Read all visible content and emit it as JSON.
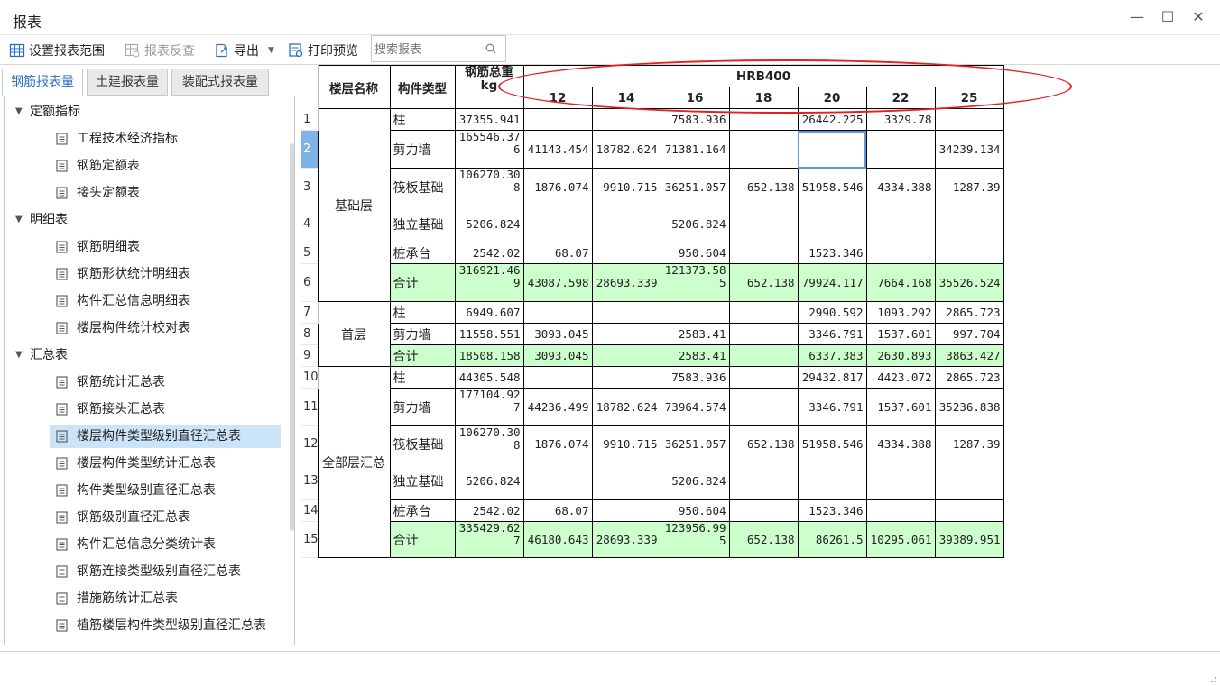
{
  "window": {
    "title": "报表",
    "minimize": "—",
    "maximize": "☐",
    "close": "✕"
  },
  "toolbar": {
    "set_range": "设置报表范围",
    "reverse_check": "报表反查",
    "export": "导出",
    "print_preview": "打印预览",
    "search_placeholder": "搜索报表"
  },
  "tabs": [
    "钢筋报表量",
    "土建报表量",
    "装配式报表量"
  ],
  "tree": {
    "groups": [
      {
        "label": "定额指标",
        "items": [
          "工程技术经济指标",
          "钢筋定额表",
          "接头定额表"
        ]
      },
      {
        "label": "明细表",
        "items": [
          "钢筋明细表",
          "钢筋形状统计明细表",
          "构件汇总信息明细表",
          "楼层构件统计校对表"
        ]
      },
      {
        "label": "汇总表",
        "items": [
          "钢筋统计汇总表",
          "钢筋接头汇总表",
          "楼层构件类型级别直径汇总表",
          "楼层构件类型统计汇总表",
          "构件类型级别直径汇总表",
          "钢筋级别直径汇总表",
          "构件汇总信息分类统计表",
          "钢筋连接类型级别直径汇总表",
          "措施筋统计汇总表",
          "植筋楼层构件类型级别直径汇总表"
        ]
      }
    ],
    "selected": "楼层构件类型级别直径汇总表"
  },
  "report": {
    "headers": {
      "floor": "楼层名称",
      "type": "构件类型",
      "total": "钢筋总重kg",
      "grade": "HRB400",
      "diameters": [
        "12",
        "14",
        "16",
        "18",
        "20",
        "22",
        "25"
      ]
    },
    "groups": [
      {
        "floor": "基础层",
        "rows": [
          {
            "no": "1",
            "type": "柱",
            "total": "37355.941",
            "vals": [
              "",
              "",
              "7583.936",
              "",
              "26442.225",
              "3329.78",
              ""
            ]
          },
          {
            "no": "2",
            "type": "剪力墙",
            "total": "165546.376",
            "vals": [
              "41143.454",
              "18782.624",
              "71381.164",
              "",
              "",
              "",
              "34239.134"
            ]
          },
          {
            "no": "3",
            "type": "筏板基础",
            "total": "106270.308",
            "vals": [
              "1876.074",
              "9910.715",
              "36251.057",
              "652.138",
              "51958.546",
              "4334.388",
              "1287.39"
            ]
          },
          {
            "no": "4",
            "type": "独立基础",
            "total": "5206.824",
            "vals": [
              "",
              "",
              "5206.824",
              "",
              "",
              "",
              ""
            ]
          },
          {
            "no": "5",
            "type": "桩承台",
            "total": "2542.02",
            "vals": [
              "68.07",
              "",
              "950.604",
              "",
              "1523.346",
              "",
              ""
            ]
          },
          {
            "no": "6",
            "type": "合计",
            "total": "316921.469",
            "vals": [
              "43087.598",
              "28693.339",
              "121373.585",
              "652.138",
              "79924.117",
              "7664.168",
              "35526.524"
            ],
            "sum": true
          }
        ]
      },
      {
        "floor": "首层",
        "rows": [
          {
            "no": "7",
            "type": "柱",
            "total": "6949.607",
            "vals": [
              "",
              "",
              "",
              "",
              "2990.592",
              "1093.292",
              "2865.723"
            ]
          },
          {
            "no": "8",
            "type": "剪力墙",
            "total": "11558.551",
            "vals": [
              "3093.045",
              "",
              "2583.41",
              "",
              "3346.791",
              "1537.601",
              "997.704"
            ]
          },
          {
            "no": "9",
            "type": "合计",
            "total": "18508.158",
            "vals": [
              "3093.045",
              "",
              "2583.41",
              "",
              "6337.383",
              "2630.893",
              "3863.427"
            ],
            "sum": true
          }
        ]
      },
      {
        "floor": "全部层汇总",
        "rows": [
          {
            "no": "10",
            "type": "柱",
            "total": "44305.548",
            "vals": [
              "",
              "",
              "7583.936",
              "",
              "29432.817",
              "4423.072",
              "2865.723"
            ]
          },
          {
            "no": "11",
            "type": "剪力墙",
            "total": "177104.927",
            "vals": [
              "44236.499",
              "18782.624",
              "73964.574",
              "",
              "3346.791",
              "1537.601",
              "35236.838"
            ]
          },
          {
            "no": "12",
            "type": "筏板基础",
            "total": "106270.308",
            "vals": [
              "1876.074",
              "9910.715",
              "36251.057",
              "652.138",
              "51958.546",
              "4334.388",
              "1287.39"
            ]
          },
          {
            "no": "13",
            "type": "独立基础",
            "total": "5206.824",
            "vals": [
              "",
              "",
              "5206.824",
              "",
              "",
              "",
              ""
            ]
          },
          {
            "no": "14",
            "type": "桩承台",
            "total": "2542.02",
            "vals": [
              "68.07",
              "",
              "950.604",
              "",
              "1523.346",
              "",
              ""
            ]
          },
          {
            "no": "15",
            "type": "合计",
            "total": "335429.627",
            "vals": [
              "46180.643",
              "28693.339",
              "123956.995",
              "652.138",
              "86261.5",
              "10295.061",
              "39389.951"
            ],
            "sum": true
          }
        ]
      }
    ],
    "active_row": "2"
  },
  "colors": {
    "sum_bg": "#ccffcc",
    "highlight": "#e62020",
    "selection": "#cce4f7",
    "tab_active": "#2b6fc4"
  }
}
